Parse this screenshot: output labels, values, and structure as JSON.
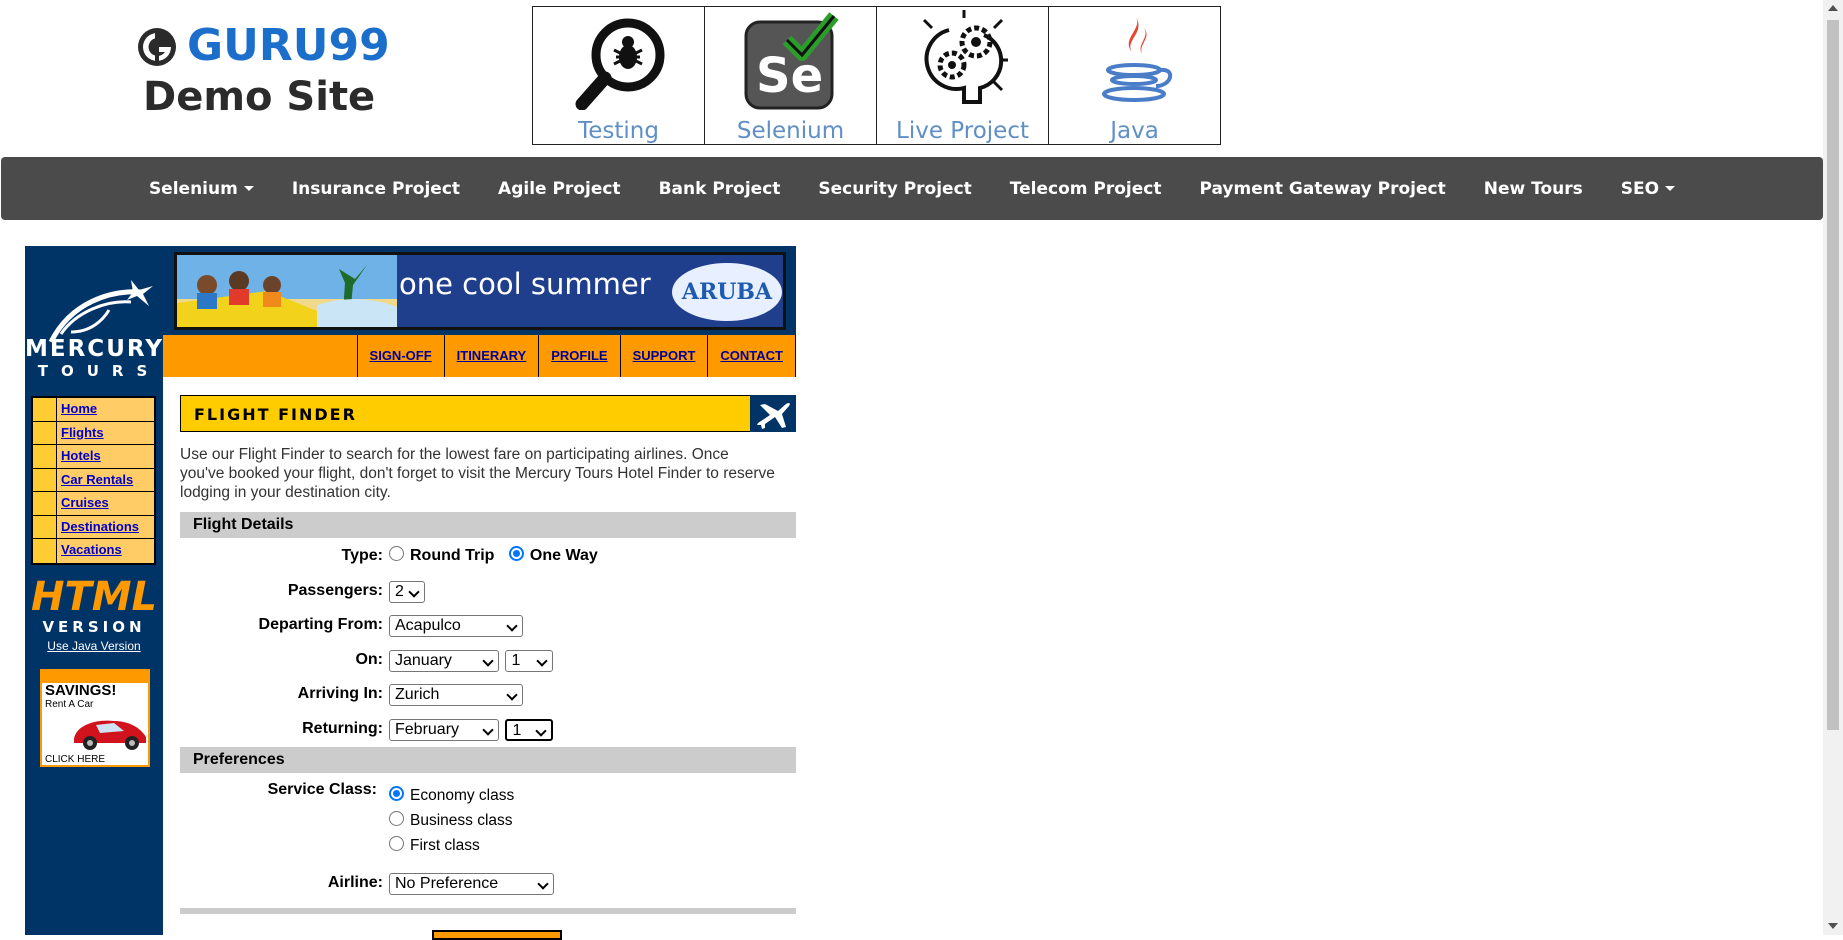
{
  "header": {
    "logo_text": "GURU99",
    "logo_sub": "Demo Site",
    "courses": [
      {
        "label": "Testing",
        "icon": "magnifier-bug-icon"
      },
      {
        "label": "Selenium",
        "icon": "selenium-icon"
      },
      {
        "label": "Live Project",
        "icon": "lightbulb-gears-icon"
      },
      {
        "label": "Java",
        "icon": "java-cup-icon"
      }
    ]
  },
  "navbar": {
    "items": [
      "Selenium",
      "Insurance Project",
      "Agile Project",
      "Bank Project",
      "Security Project",
      "Telecom Project",
      "Payment Gateway Project",
      "New Tours",
      "SEO"
    ]
  },
  "mercury": {
    "brand_line1": "MERCURY",
    "brand_line2": "TOURS",
    "menu": [
      "Home",
      "Flights",
      "Hotels",
      "Car Rentals",
      "Cruises",
      "Destinations",
      "Vacations"
    ],
    "html_big": "HTML",
    "html_ver": "VERSION",
    "java_link": "Use Java Version",
    "savings_title": "SAVINGS!",
    "savings_sub": "Rent A Car",
    "savings_click": "CLICK HERE"
  },
  "banner": {
    "text": "one cool summer",
    "brand": "ARUBA"
  },
  "top_links": [
    "SIGN-OFF",
    "ITINERARY",
    "PROFILE",
    "SUPPORT",
    "CONTACT"
  ],
  "finder": {
    "title": "FLIGHT FINDER",
    "intro": "Use our Flight Finder to search for the lowest fare on participating airlines. Once you've booked your flight, don't forget to visit the Mercury Tours Hotel Finder to reserve lodging in your destination city.",
    "details_title": "Flight Details",
    "type_label": "Type:",
    "type_round": "Round Trip",
    "type_oneway": "One Way",
    "passengers_label": "Passengers:",
    "passengers_value": "2",
    "departing_label": "Departing From:",
    "departing_value": "Acapulco",
    "on_label": "On:",
    "on_month": "January",
    "on_day": "1",
    "arriving_label": "Arriving In:",
    "arriving_value": "Zurich",
    "returning_label": "Returning:",
    "returning_month": "February",
    "returning_day": "1",
    "prefs_title": "Preferences",
    "service_label": "Service Class:",
    "service_economy": "Economy class",
    "service_business": "Business class",
    "service_first": "First class",
    "airline_label": "Airline:",
    "airline_value": "No Preference"
  },
  "colors": {
    "nav_bg": "#4b4b4b",
    "mercury_blue": "#003366",
    "orange": "#ff9900",
    "yellow": "#ffcc00",
    "link_blue": "#0000cc"
  }
}
